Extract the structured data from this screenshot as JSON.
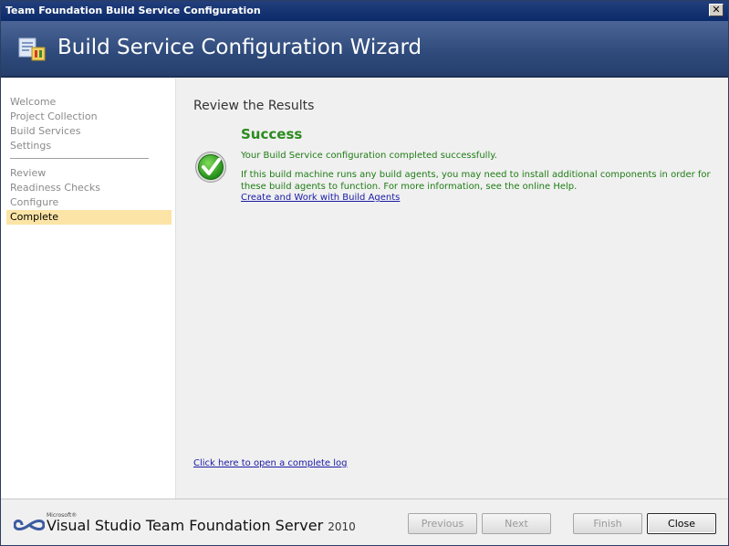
{
  "window": {
    "title": "Team Foundation Build Service Configuration",
    "close_label": "✕"
  },
  "banner": {
    "title": "Build Service Configuration Wizard",
    "icon": "build-wizard-icon"
  },
  "sidebar": {
    "items": [
      {
        "label": "Welcome",
        "state": "inactive"
      },
      {
        "label": "Project Collection",
        "state": "inactive"
      },
      {
        "label": "Build Services",
        "state": "inactive"
      },
      {
        "label": "Settings",
        "state": "inactive"
      },
      {
        "label": "Review",
        "state": "inactive"
      },
      {
        "label": "Readiness Checks",
        "state": "inactive"
      },
      {
        "label": "Configure",
        "state": "inactive"
      },
      {
        "label": "Complete",
        "state": "active"
      }
    ]
  },
  "main": {
    "heading": "Review the Results",
    "status": {
      "title": "Success",
      "line1": "Your Build Service configuration completed successfully.",
      "line2": "If this build machine runs any build agents, you may need to install additional components in order for these build agents to function. For more information, see the online Help.",
      "link": "Create and Work with Build Agents",
      "icon": "success-checkmark-icon"
    },
    "log_link": "Click here to open a complete log"
  },
  "footer": {
    "logo": {
      "ms": "Microsoft®",
      "product": "Visual Studio",
      "suffix": " Team Foundation Server",
      "version": "2010"
    },
    "buttons": {
      "previous": "Previous",
      "next": "Next",
      "finish": "Finish",
      "close": "Close"
    }
  },
  "colors": {
    "success_green": "#1e7d14",
    "active_nav": "#fbe4a6",
    "banner": "#2e4a7a"
  }
}
